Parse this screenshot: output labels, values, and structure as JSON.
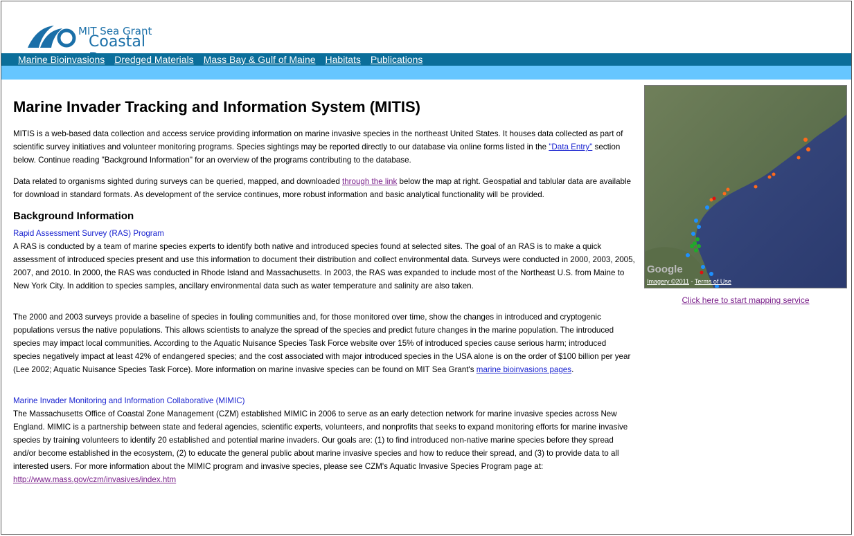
{
  "header": {
    "logo_line1": "MIT Sea Grant",
    "logo_line2": "Coastal Resources",
    "nav": [
      "Marine Bioinvasions",
      "Dredged Materials",
      "Mass Bay & Gulf of Maine",
      "Habitats",
      "Publications"
    ]
  },
  "main": {
    "title": "Marine Invader Tracking and Information System (MITIS)",
    "intro_p1_a": "MITIS is a web-based data collection and access service providing information on marine invasive species in the northeast United States. It houses data collected as part of scientific survey initiatives and volunteer monitoring programs. Species sightings may be reported directly to our database via online forms listed in the ",
    "intro_p1_link": "\"Data Entry\"",
    "intro_p1_b": " section below. Continue reading \"Background Information\" for an overview of the programs contributing to the database.",
    "intro_p2_a": "Data related to organisms sighted during surveys can be queried, mapped, and downloaded ",
    "intro_p2_link": "through the link",
    "intro_p2_b": " below the map at right. Geospatial and tablular data are available for download in standard formats. As development of the service continues, more robust information and basic analytical functionality will be provided.",
    "background_heading": "Background Information",
    "ras_heading": "Rapid Assessment Survey (RAS) Program",
    "ras_p1": "A RAS is conducted by a team of marine species experts to identify both native and introduced species found at selected sites. The goal of an RAS is to make a quick assessment of introduced species present and use this information to document their distribution and collect environmental data. Surveys were conducted in 2000, 2003, 2005, 2007, and 2010. In 2000, the RAS was conducted in Rhode Island and Massachusetts. In 2003, the RAS was expanded to include most of the Northeast U.S. from Maine to New York City. In addition to species samples, ancillary environmental data such as water temperature and salinity are also taken.",
    "ras_p2_a": "The 2000 and 2003 surveys provide a baseline of species in fouling communities and, for those monitored over time, show the changes in introduced and cryptogenic populations versus the native populations. This allows scientists to analyze the spread of the species and predict future changes in the marine population. The introduced species may impact local communities. According to the Aquatic Nuisance Species Task Force website over 15% of introduced species cause serious harm; introduced species negatively impact at least 42% of endangered species; and the cost associated with major introduced species in the USA alone is on the order of $100 billion per year (Lee 2002; Aquatic Nuisance Species Task Force). More information on marine invasive species can be found on MIT Sea Grant's ",
    "ras_p2_link": "marine bioinvasions pages",
    "ras_p2_b": ".",
    "mimic_heading": "Marine Invader Monitoring and Information Collaborative (MIMIC)",
    "mimic_p_a": "The Massachusetts Office of Coastal Zone Management (CZM) established MIMIC in 2006 to serve as an early detection network for marine invasive species across New England. MIMIC is a partnership between state and federal agencies, scientific experts, volunteers, and nonprofits that seeks to expand monitoring efforts for marine invasive species by training volunteers to identify 20 established and potential marine invaders. Our goals are: (1) to find introduced non-native marine species before they spread and/or become established in the ecosystem, (2) to educate the general public about marine invasive species and how to reduce their spread, and (3) to provide data to all interested users. For more information about the MIMIC program and invasive species, please see CZM's Aquatic Invasive Species Program page at: ",
    "mimic_p_link": "http://www.mass.gov/czm/invasives/index.htm"
  },
  "sidebar": {
    "map_google_label": "Google",
    "map_imagery": "Imagery ©2011",
    "map_terms": "Terms of Use",
    "mapping_link": "Click here to start mapping service"
  },
  "colors": {
    "nav_bg": "#0b6e9a",
    "subbar_bg": "#66c6ff",
    "logo_blue": "#1a6fa8",
    "link_blue": "#1a23d0",
    "link_visited": "#7a1f8a"
  }
}
